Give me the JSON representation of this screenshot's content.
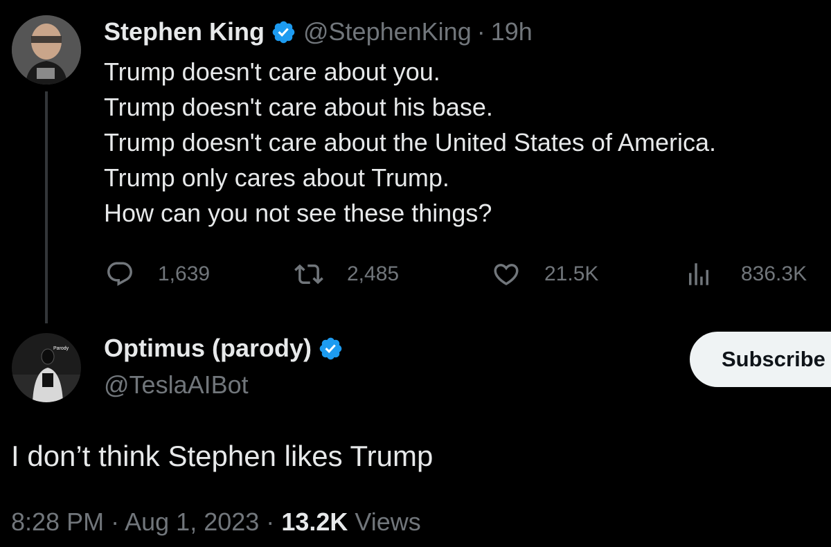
{
  "colors": {
    "background": "#000000",
    "text": "#e7e9ea",
    "secondary": "#71767b",
    "verified_blue": "#1d9bf0",
    "thread_line": "#333639",
    "button_bg": "#eff3f4"
  },
  "parent_tweet": {
    "display_name": "Stephen King",
    "handle": "@StephenKing",
    "separator": "·",
    "time": "19h",
    "verified_icon": "verified-badge-icon",
    "lines": [
      "Trump doesn't care about you.",
      "Trump doesn't care about his base.",
      "Trump doesn't care about the United States of America.",
      "Trump only cares about Trump.",
      "How can you not see these things?"
    ],
    "actions": {
      "replies": "1,639",
      "retweets": "2,485",
      "likes": "21.5K",
      "views": "836.3K"
    }
  },
  "reply_tweet": {
    "display_name": "Optimus (parody)",
    "handle": "@TeslaAIBot",
    "verified_icon": "verified-badge-icon",
    "avatar_label": "Parody",
    "subscribe_label": "Subscribe",
    "text": "I don’t think Stephen likes Trump",
    "time": "8:28 PM",
    "separator": "·",
    "date": "Aug 1, 2023",
    "views_count": "13.2K",
    "views_label": "Views"
  }
}
